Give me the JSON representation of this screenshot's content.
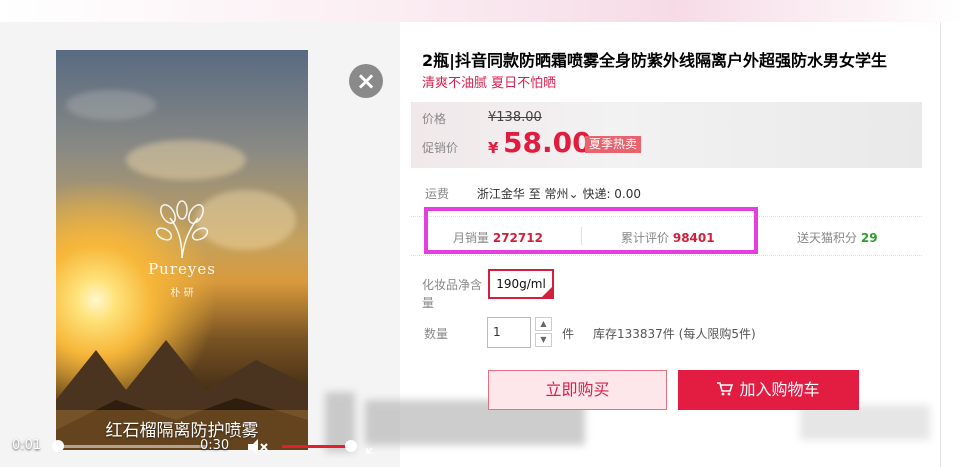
{
  "product": {
    "title": "2瓶|抖音同款防晒霜喷雾全身防紫外线隔离户外超强防水男女学生",
    "subtitle": "清爽不油腻 夏日不怕晒"
  },
  "video": {
    "brand": "Pureyes",
    "brand_sub": "朴 研",
    "caption": "红石榴隔离防护喷雾",
    "current_time": "0:01",
    "duration": "0:30",
    "progress": 0.03,
    "volume": 1.0
  },
  "price": {
    "list_label": "价格",
    "list_value": "¥138.00",
    "promo_label": "促销价",
    "currency": "¥",
    "sale_value": "58.00",
    "promo_tag": "夏季热卖"
  },
  "shipping": {
    "label": "运费",
    "from": "浙江金华",
    "to_word": "至",
    "to": "常州",
    "express": "快递: 0.00"
  },
  "stats": {
    "monthly_label": "月销量",
    "monthly_value": "272712",
    "reviews_label": "累计评价",
    "reviews_value": "98401",
    "points_label": "送天猫积分",
    "points_value": "29"
  },
  "spec": {
    "label": "化妆品净含量",
    "option": "190g/ml"
  },
  "quantity": {
    "label": "数量",
    "value": "1",
    "unit": "件",
    "stock": "库存133837件",
    "limit": "(每人限购5件)"
  },
  "actions": {
    "buy_now": "立即购买",
    "add_cart": "加入购物车"
  },
  "colors": {
    "accent": "#e31c42",
    "highlight": "#e43de0"
  }
}
